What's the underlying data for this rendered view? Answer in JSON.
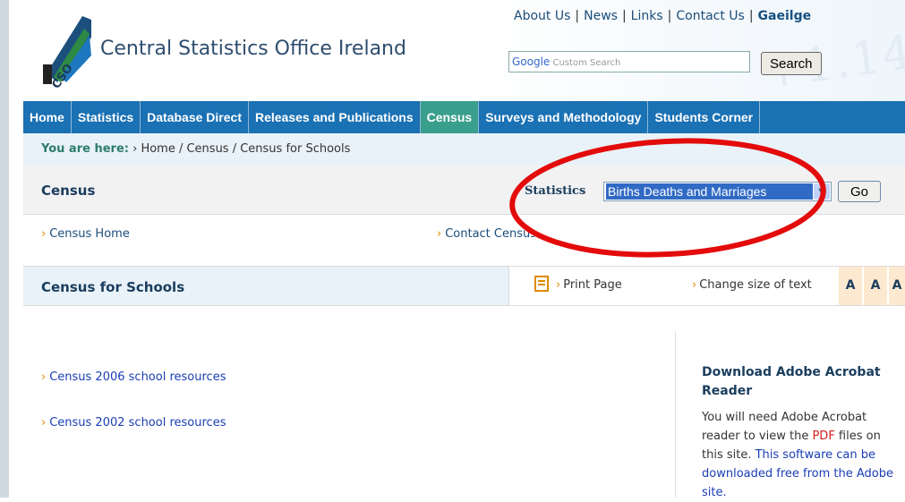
{
  "header": {
    "site_title": "Central Statistics Office Ireland",
    "logo_text": "CSO",
    "top_links": [
      "About Us",
      "News",
      "Links",
      "Contact Us",
      "Gaeilge"
    ],
    "search_placeholder_brand": "Google",
    "search_placeholder": "Custom Search",
    "search_button": "Search",
    "background_digits": "+1.14"
  },
  "nav": {
    "items": [
      "Home",
      "Statistics",
      "Database Direct",
      "Releases and Publications",
      "Census",
      "Surveys and Methodology",
      "Students Corner"
    ],
    "active": "Census",
    "color": "#1a71b4",
    "active_color": "#3a9e8d"
  },
  "breadcrumb": {
    "label": "You are here:",
    "path": "› Home / Census / Census for Schools"
  },
  "section": {
    "title": "Census",
    "stats_label": "Statistics",
    "stats_selected": "Births Deaths and Marriages",
    "go_button": "Go"
  },
  "sublinks": [
    "Census Home",
    "Contact Census"
  ],
  "page_bar": {
    "title": "Census for Schools",
    "print": "Print Page",
    "size_label": "Change size of text",
    "size_options": [
      "A",
      "A",
      "A"
    ]
  },
  "content": {
    "links": [
      "Census 2006 school resources",
      "Census 2002 school resources"
    ]
  },
  "sidebar": {
    "title": "Download Adobe Acrobat Reader",
    "text_1": "You will need Adobe Acrobat reader to view the ",
    "pdf": "PDF",
    "text_2": " files on this site. ",
    "text_3": "This software can be downloaded free from the Adobe site."
  },
  "annotation": {
    "color": "#e30b0b"
  }
}
